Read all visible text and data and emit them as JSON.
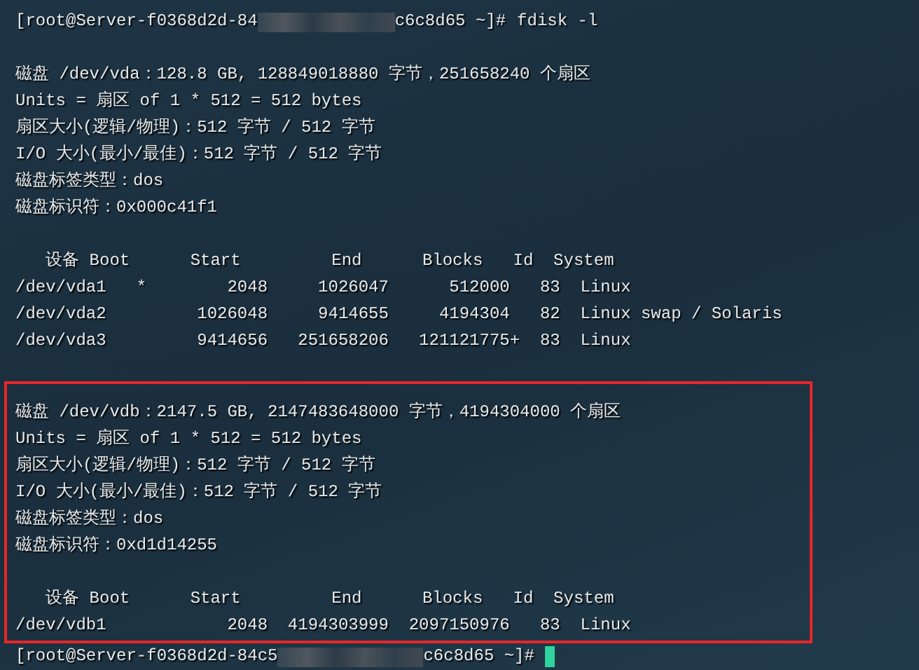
{
  "terminal": {
    "prompt_top": {
      "before_redaction": "[root@Server-f0368d2d-84",
      "after_redaction": "c6c8d65 ~]#",
      "command": "fdisk -l"
    },
    "disks": [
      {
        "highlighted": false,
        "info_lines": [
          "磁盘 /dev/vda：128.8 GB, 128849018880 字节，251658240 个扇区",
          "Units = 扇区 of 1 * 512 = 512 bytes",
          "扇区大小(逻辑/物理)：512 字节 / 512 字节",
          "I/O 大小(最小/最佳)：512 字节 / 512 字节",
          "磁盘标签类型：dos",
          "磁盘标识符：0x000c41f1"
        ],
        "table": {
          "header": "   设备 Boot      Start         End      Blocks   Id  System",
          "rows": [
            "/dev/vda1   *        2048     1026047      512000   83  Linux",
            "/dev/vda2         1026048     9414655     4194304   82  Linux swap / Solaris",
            "/dev/vda3         9414656   251658206   121121775+  83  Linux"
          ]
        }
      },
      {
        "highlighted": true,
        "info_lines": [
          "磁盘 /dev/vdb：2147.5 GB, 2147483648000 字节，4194304000 个扇区",
          "Units = 扇区 of 1 * 512 = 512 bytes",
          "扇区大小(逻辑/物理)：512 字节 / 512 字节",
          "I/O 大小(最小/最佳)：512 字节 / 512 字节",
          "磁盘标签类型：dos",
          "磁盘标识符：0xd1d14255"
        ],
        "table": {
          "header": "   设备 Boot      Start         End      Blocks   Id  System",
          "rows": [
            "/dev/vdb1            2048  4194303999  2097150976   83  Linux"
          ]
        }
      }
    ],
    "prompt_bottom": {
      "before_redaction": "[root@Server-f0368d2d-84c5",
      "after_redaction": "c6c8d65 ~]#",
      "cursor": true
    }
  }
}
